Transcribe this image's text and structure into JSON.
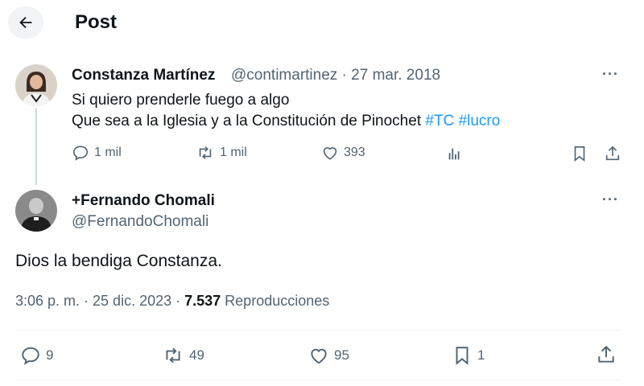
{
  "header": {
    "title": "Post"
  },
  "quoted_post": {
    "author_name": "Constanza Martínez",
    "meta": "@contimartinez · 27 mar. 2018",
    "text_line1": "Si quiero prenderle fuego a algo",
    "text_line2_prefix": "Que sea a la Iglesia y a la Constitución de Pinochet ",
    "hashtag1": "#TC",
    "hashtag2": "#lucro",
    "replies": "1 mil",
    "reposts": "1 mil",
    "likes": "393",
    "more_label": "···"
  },
  "main_post": {
    "author_name": "+Fernando Chomali",
    "handle": "@FernandoChomali",
    "text": "Dios la bendiga Constanza.",
    "time_date": "3:06 p. m. · 25 dic. 2023 · ",
    "views_count": "7.537",
    "views_label": " Reproducciones",
    "replies": "9",
    "reposts": "49",
    "likes": "95",
    "bookmarks": "1",
    "more_label": "···"
  },
  "colors": {
    "accent": "#1d9bf0",
    "secondary_text": "#536471",
    "text": "#0f1419"
  }
}
